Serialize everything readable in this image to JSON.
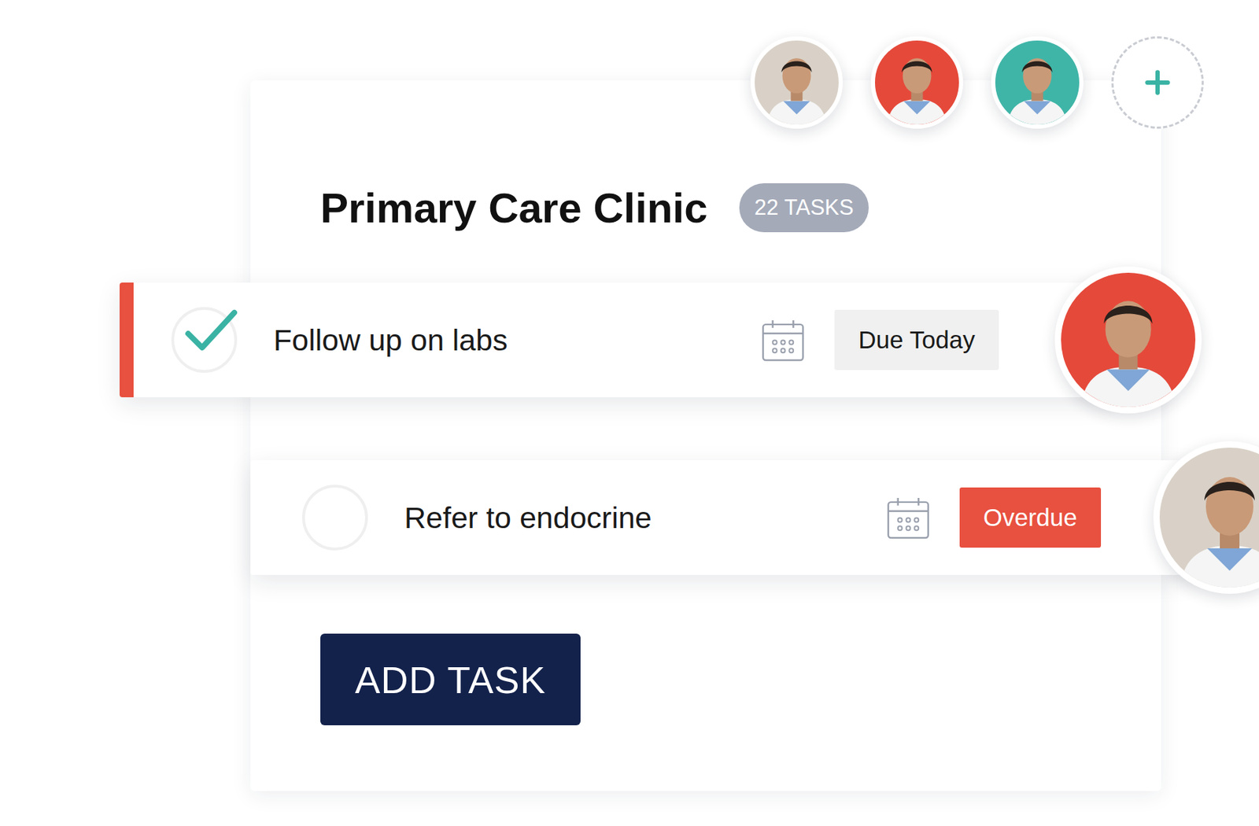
{
  "clinic": {
    "title": "Primary Care Clinic",
    "badge": "22 TASKS"
  },
  "team": [
    {
      "color": "#d9d1c7"
    },
    {
      "color": "#e5493a"
    },
    {
      "color": "#3fb5a7"
    }
  ],
  "tasks": [
    {
      "label": "Follow up on labs",
      "checked": true,
      "selected": true,
      "due": "Due Today",
      "overdue": false,
      "assignee_color": "#e5493a"
    },
    {
      "label": "Refer to endocrine",
      "checked": false,
      "selected": false,
      "due": "Overdue",
      "overdue": true,
      "assignee_color": "#d9d1c7"
    }
  ],
  "buttons": [
    "ADD TASK"
  ]
}
